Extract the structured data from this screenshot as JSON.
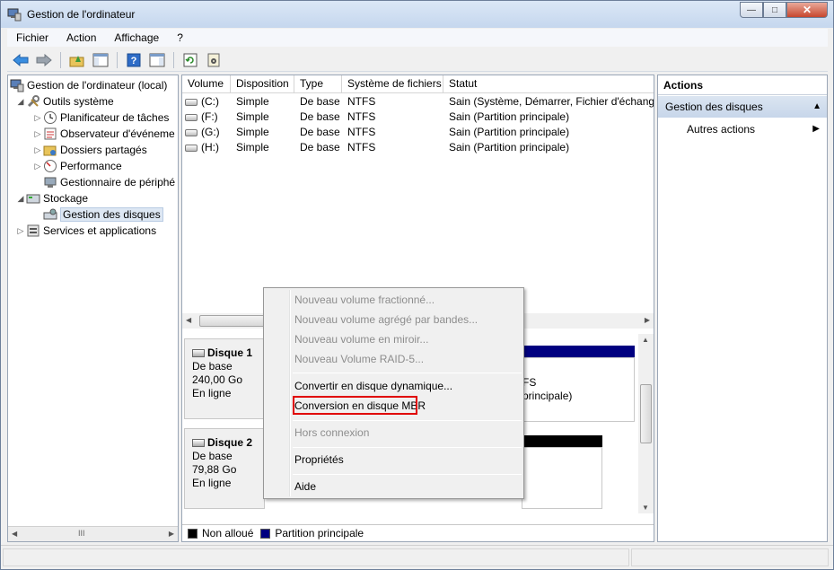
{
  "window": {
    "title": "Gestion de l'ordinateur"
  },
  "menu": [
    "Fichier",
    "Action",
    "Affichage",
    "?"
  ],
  "toolbar": [
    "back-icon",
    "forward-icon",
    "up-folder-icon",
    "show-hide-tree-icon",
    "help-icon",
    "show-hide-action-pane-icon",
    "refresh-icon",
    "properties-icon"
  ],
  "tree": {
    "root": "Gestion de l'ordinateur (local)",
    "outils": "Outils système",
    "planificateur": "Planificateur de tâches",
    "observateur": "Observateur d'événeme",
    "dossiers": "Dossiers partagés",
    "performance": "Performance",
    "gestionnaire": "Gestionnaire de périphé",
    "stockage": "Stockage",
    "gestion_disques": "Gestion des disques",
    "services": "Services et applications",
    "scroll_thumb": "III"
  },
  "volumes": {
    "headers": [
      "Volume",
      "Disposition",
      "Type",
      "Système de fichiers",
      "Statut"
    ],
    "rows": [
      [
        "(C:)",
        "Simple",
        "De base",
        "NTFS",
        "Sain (Système, Démarrer, Fichier d'échange"
      ],
      [
        "(F:)",
        "Simple",
        "De base",
        "NTFS",
        "Sain (Partition principale)"
      ],
      [
        "(G:)",
        "Simple",
        "De base",
        "NTFS",
        "Sain (Partition principale)"
      ],
      [
        "(H:)",
        "Simple",
        "De base",
        "NTFS",
        "Sain (Partition principale)"
      ]
    ]
  },
  "disks": [
    {
      "name": "Disque 1",
      "type": "De base",
      "size": "240,00 Go",
      "state": "En ligne",
      "part_fs": "FS",
      "part_status": "principale)"
    },
    {
      "name": "Disque 2",
      "type": "De base",
      "size": "79,88 Go",
      "state": "En ligne"
    }
  ],
  "legend": {
    "unallocated": "Non alloué",
    "primary": "Partition principale",
    "unallocated_color": "#000000",
    "primary_color": "#000080"
  },
  "actions": {
    "header": "Actions",
    "section": "Gestion des disques",
    "more": "Autres actions"
  },
  "context_menu": {
    "new_spanned": "Nouveau volume fractionné...",
    "new_striped": "Nouveau volume agrégé par bandes...",
    "new_mirror": "Nouveau volume en miroir...",
    "new_raid5": "Nouveau Volume RAID-5...",
    "convert_dynamic": "Convertir en disque dynamique...",
    "convert_mbr": "Conversion en disque MBR",
    "offline": "Hors connexion",
    "properties": "Propriétés",
    "help": "Aide"
  }
}
